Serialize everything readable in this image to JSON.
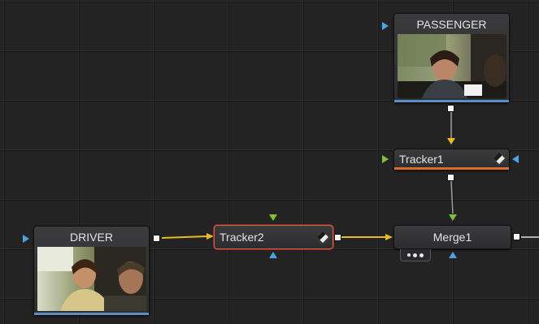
{
  "nodes": {
    "passenger": {
      "label": "PASSENGER"
    },
    "tracker1": {
      "label": "Tracker1"
    },
    "tracker2": {
      "label": "Tracker2"
    },
    "merge1": {
      "label": "Merge1"
    },
    "driver": {
      "label": "DRIVER"
    }
  },
  "colors": {
    "background_input": "#4fa3e0",
    "foreground_input": "#7fc23a",
    "mask_input": "#4fa3e0",
    "image_wire": "#e8b923",
    "selected_outline": "#e0604a",
    "tracker_underline": "#e06a2a",
    "media_underline": "#5b8fc4"
  },
  "icons": [
    "tracker-diamond-icon",
    "input-triangle-icon",
    "output-square-icon",
    "more-dots-icon"
  ]
}
